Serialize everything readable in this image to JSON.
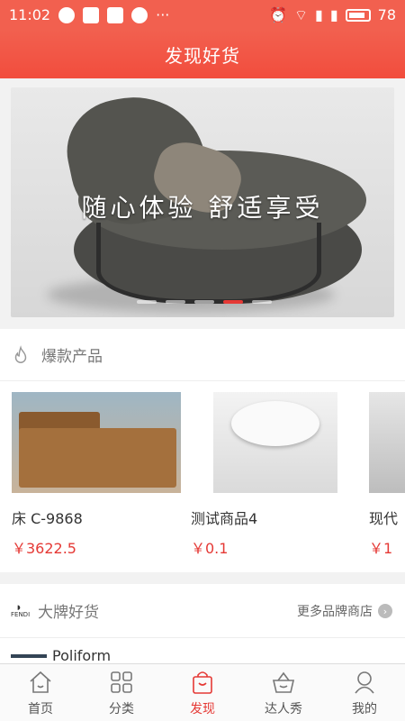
{
  "status_bar": {
    "time": "11:02",
    "more": "···",
    "battery": "78"
  },
  "header": {
    "title": "发现好货"
  },
  "banner": {
    "text": "随心体验 舒适享受",
    "active_dot": 4,
    "dot_count": 5
  },
  "hot_section": {
    "title": "爆款产品",
    "products": [
      {
        "name": "床 C-9868",
        "price": "￥3622.5"
      },
      {
        "name": "测试商品4",
        "price": "￥0.1"
      },
      {
        "name": "现代",
        "price": "￥1"
      }
    ]
  },
  "brand_section": {
    "logo_text": "FENDI",
    "title": "大牌好货",
    "more_label": "更多品牌商店",
    "first_brand": "Poliform"
  },
  "tabbar": {
    "items": [
      {
        "label": "首页",
        "icon": "home-icon"
      },
      {
        "label": "分类",
        "icon": "grid-icon"
      },
      {
        "label": "发现",
        "icon": "bag-icon",
        "active": true
      },
      {
        "label": "达人秀",
        "icon": "basket-icon"
      },
      {
        "label": "我的",
        "icon": "person-icon"
      }
    ]
  },
  "colors": {
    "accent": "#f2604f",
    "price": "#e53935"
  }
}
